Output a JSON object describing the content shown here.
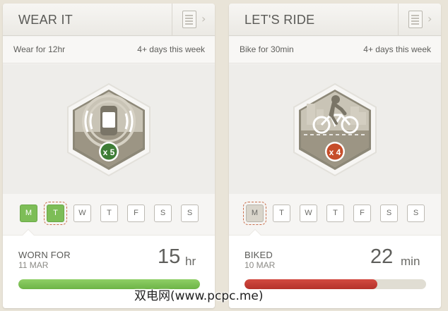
{
  "cards": [
    {
      "title": "WEAR IT",
      "goal": "Wear for 12hr",
      "frequency": "4+ days this week",
      "badge": {
        "icon": "tracker-band-icon",
        "multiplier": "x 5",
        "color": "#3f7d37"
      },
      "days": [
        {
          "label": "M",
          "state": "done"
        },
        {
          "label": "T",
          "state": "done",
          "today": true
        },
        {
          "label": "W",
          "state": "empty"
        },
        {
          "label": "T",
          "state": "empty"
        },
        {
          "label": "F",
          "state": "empty"
        },
        {
          "label": "S",
          "state": "empty"
        },
        {
          "label": "S",
          "state": "empty"
        }
      ],
      "stat_label": "WORN FOR",
      "stat_date": "11 MAR",
      "stat_value": "15",
      "stat_unit": "hr",
      "progress": 1.0,
      "progress_color": "#7dbd57"
    },
    {
      "title": "LET'S RIDE",
      "goal": "Bike for 30min",
      "frequency": "4+ days this week",
      "badge": {
        "icon": "bicycle-rider-icon",
        "multiplier": "x 4",
        "color": "#c64d2a"
      },
      "days": [
        {
          "label": "M",
          "state": "partial",
          "today": true
        },
        {
          "label": "T",
          "state": "empty"
        },
        {
          "label": "W",
          "state": "empty"
        },
        {
          "label": "T",
          "state": "empty"
        },
        {
          "label": "F",
          "state": "empty"
        },
        {
          "label": "S",
          "state": "empty"
        },
        {
          "label": "S",
          "state": "empty"
        }
      ],
      "stat_label": "BIKED",
      "stat_date": "10 MAR",
      "stat_value": "22",
      "stat_unit": "min",
      "progress": 0.73,
      "progress_color": "#c23a32"
    }
  ],
  "watermark": "双电网(www.pcpc.me)"
}
